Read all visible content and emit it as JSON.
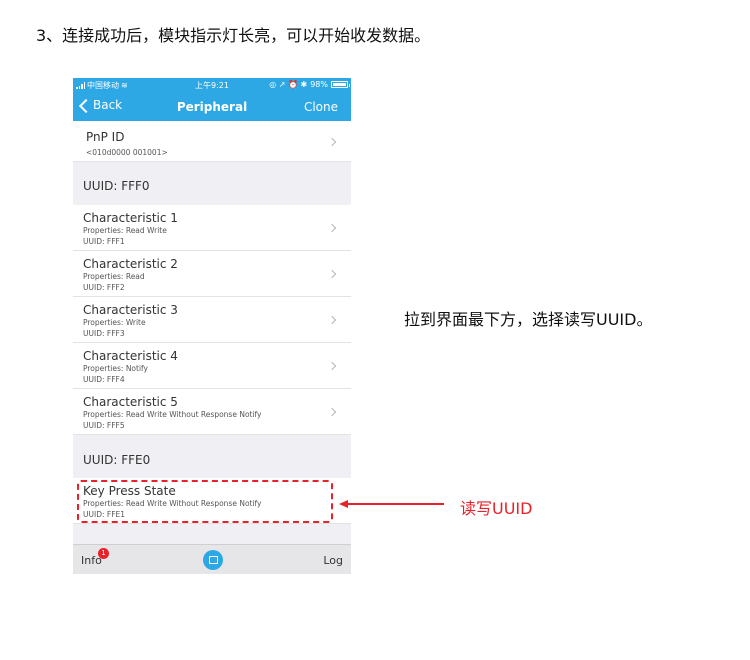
{
  "step_title": "3、连接成功后，模块指示灯长亮，可以开始收发数据。",
  "side_note": "拉到界面最下方，选择读写UUID。",
  "callout_label": "读写UUID",
  "status_bar": {
    "carrier": "中国移动",
    "time": "上午9:21",
    "indicators": "◎ ↗ ⏰ ✱",
    "battery_text": "98%",
    "battery_level": 0.98
  },
  "nav": {
    "back": "Back",
    "title": "Peripheral",
    "action": "Clone"
  },
  "pnp": {
    "title": "PnP ID",
    "value": "<010d0000 001001>"
  },
  "sections": [
    {
      "header": "UUID: FFF0",
      "characteristics": [
        {
          "name": "Characteristic 1",
          "properties": "Properties: Read Write",
          "uuid": "UUID: FFF1"
        },
        {
          "name": "Characteristic 2",
          "properties": "Properties: Read",
          "uuid": "UUID: FFF2"
        },
        {
          "name": "Characteristic 3",
          "properties": "Properties: Write",
          "uuid": "UUID: FFF3"
        },
        {
          "name": "Characteristic 4",
          "properties": "Properties: Notify",
          "uuid": "UUID: FFF4"
        },
        {
          "name": "Characteristic 5",
          "properties": "Properties: Read Write Without Response Notify",
          "uuid": "UUID: FFF5"
        }
      ]
    },
    {
      "header": "UUID: FFE0",
      "characteristics": [
        {
          "name": "Key Press State",
          "properties": "Properties: Read Write Without Response Notify",
          "uuid": "UUID: FFE1"
        }
      ]
    }
  ],
  "tab_bar": {
    "info": "Info",
    "info_badge": "1",
    "log": "Log"
  },
  "colors": {
    "accent": "#2ea8e5",
    "highlight": "#e8222a"
  }
}
